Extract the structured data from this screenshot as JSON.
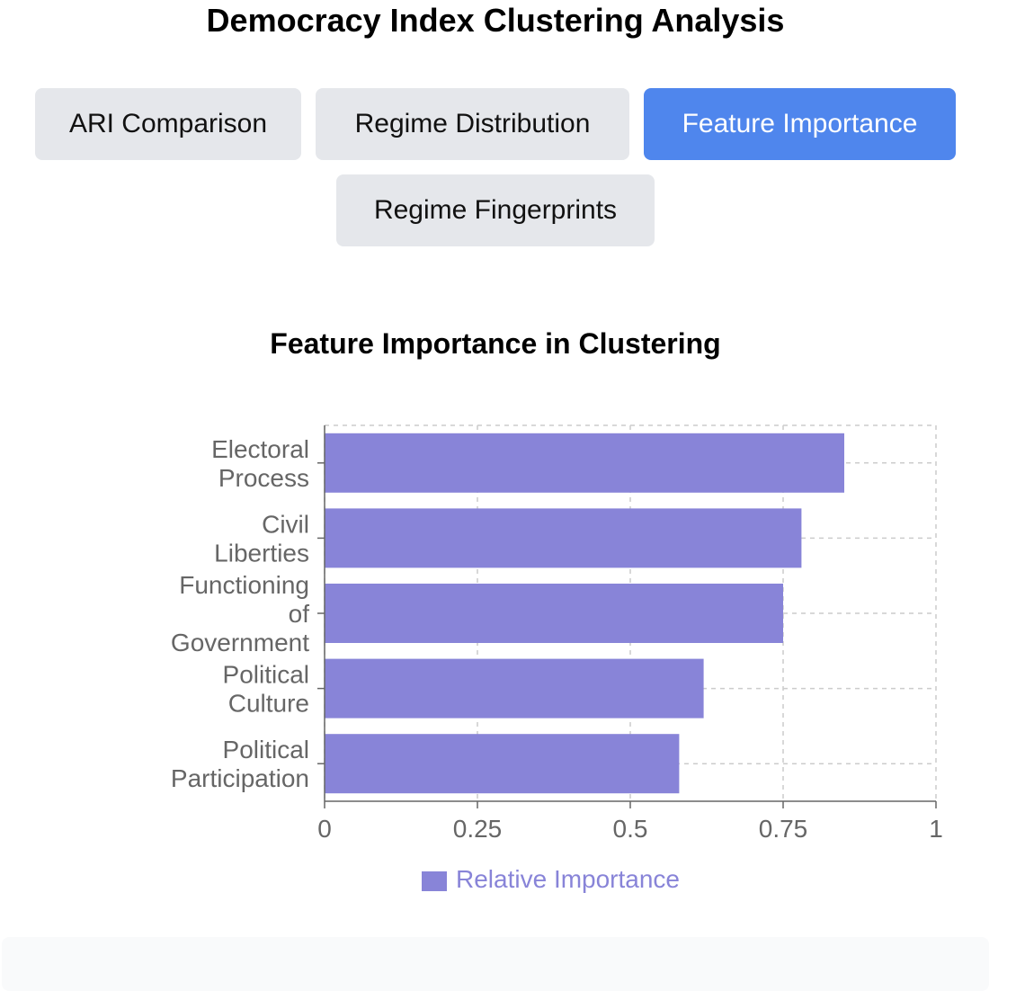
{
  "page": {
    "title": "Democracy Index Clustering Analysis"
  },
  "tabs": [
    {
      "label": "ARI Comparison",
      "active": false
    },
    {
      "label": "Regime Distribution",
      "active": false
    },
    {
      "label": "Feature Importance",
      "active": true
    },
    {
      "label": "Regime Fingerprints",
      "active": false
    }
  ],
  "colors": {
    "accent": "#4f86ed",
    "tab_bg": "#e5e7eb",
    "bar": "#8884d8",
    "axis_text": "#666666",
    "grid": "#cccccc"
  },
  "chart_data": {
    "type": "bar",
    "orientation": "horizontal",
    "title": "Feature Importance in Clustering",
    "categories": [
      "Electoral Process",
      "Civil Liberties",
      "Functioning of Government",
      "Political Culture",
      "Political Participation"
    ],
    "category_lines": [
      [
        "Electoral",
        "Process"
      ],
      [
        "Civil",
        "Liberties"
      ],
      [
        "Functioning",
        "of",
        "Government"
      ],
      [
        "Political",
        "Culture"
      ],
      [
        "Political",
        "Participation"
      ]
    ],
    "series": [
      {
        "name": "Relative Importance",
        "values": [
          0.85,
          0.78,
          0.75,
          0.62,
          0.58
        ]
      }
    ],
    "xlim": [
      0,
      1
    ],
    "xticks": [
      0,
      0.25,
      0.5,
      0.75,
      1
    ],
    "xtick_labels": [
      "0",
      "0.25",
      "0.5",
      "0.75",
      "1"
    ],
    "grid": true,
    "legend_position": "bottom-center"
  }
}
